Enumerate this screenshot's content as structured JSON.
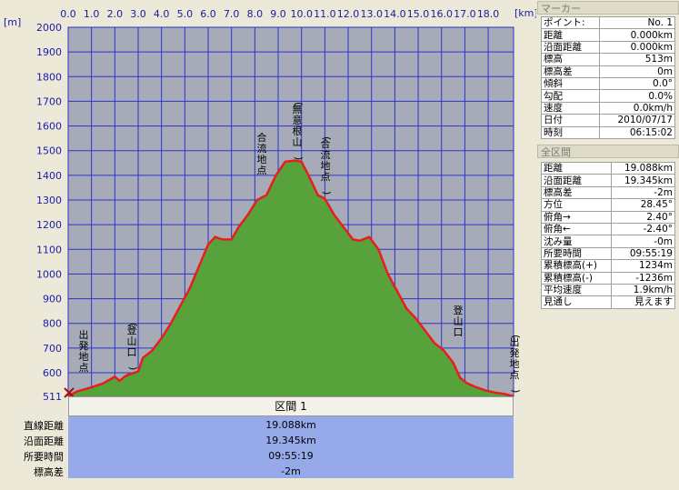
{
  "chart_data": {
    "type": "area",
    "xunit": "[km]",
    "yunit": "[m]",
    "xlim": [
      0,
      19.088
    ],
    "ylim": [
      511,
      2000
    ],
    "x_ticks": [
      "0.0",
      "1.0",
      "2.0",
      "3.0",
      "4.0",
      "5.0",
      "6.0",
      "7.0",
      "8.0",
      "9.0",
      "10.0",
      "11.0",
      "12.0",
      "13.0",
      "14.0",
      "15.0",
      "16.0",
      "17.0",
      "18.0"
    ],
    "y_ticks": [
      "2000",
      "1900",
      "1800",
      "1700",
      "1600",
      "1500",
      "1400",
      "1300",
      "1200",
      "1100",
      "1000",
      "900",
      "800",
      "700",
      "600",
      "511"
    ],
    "series": [
      {
        "x": [
          0,
          0.4,
          1.0,
          1.5,
          2.0,
          2.2,
          2.5,
          3.0,
          3.2,
          3.6,
          4.0,
          4.4,
          4.8,
          5.2,
          5.6,
          6.0,
          6.3,
          6.6,
          7.0,
          7.3,
          7.7,
          8.1,
          8.5,
          8.9,
          9.3,
          9.7,
          10.0,
          10.3,
          10.7,
          11.0,
          11.4,
          11.8,
          12.2,
          12.5,
          12.9,
          13.3,
          13.7,
          14.1,
          14.5,
          14.9,
          15.3,
          15.7,
          16.1,
          16.5,
          16.8,
          17.1,
          17.5,
          17.9,
          18.3,
          18.7,
          19.088
        ],
        "y": [
          513,
          530,
          545,
          560,
          585,
          570,
          590,
          605,
          660,
          690,
          740,
          800,
          870,
          940,
          1030,
          1120,
          1150,
          1140,
          1140,
          1190,
          1240,
          1300,
          1320,
          1400,
          1455,
          1460,
          1455,
          1400,
          1320,
          1305,
          1240,
          1190,
          1140,
          1135,
          1150,
          1100,
          1000,
          930,
          860,
          820,
          770,
          720,
          690,
          640,
          580,
          560,
          545,
          533,
          525,
          520,
          511
        ]
      }
    ],
    "annotations": [
      "出発地点",
      "(登山口)",
      "合流地点",
      "(無意根山)",
      "(合流地点)",
      "登山口",
      "(出発地点)"
    ],
    "fill": "#57a23a",
    "line": "#e81e1e",
    "grid": true
  },
  "section": {
    "header": "区間 1",
    "rows": [
      {
        "label": "直線距離",
        "value": "19.088km"
      },
      {
        "label": "沿面距離",
        "value": "19.345km"
      },
      {
        "label": "所要時間",
        "value": "09:55:19"
      },
      {
        "label": "標高差",
        "value": "-2m"
      }
    ]
  },
  "marker_panel": {
    "title": "マーカー",
    "rows": [
      {
        "label": "ポイント:",
        "value": "No. 1"
      },
      {
        "label": "距離",
        "value": "0.000km"
      },
      {
        "label": "沿面距離",
        "value": "0.000km"
      },
      {
        "label": "標高",
        "value": "513m"
      },
      {
        "label": "標高差",
        "value": "0m"
      },
      {
        "label": "傾斜",
        "value": "0.0°"
      },
      {
        "label": "勾配",
        "value": "0.0%"
      },
      {
        "label": "速度",
        "value": "0.0km/h"
      },
      {
        "label": "日付",
        "value": "2010/07/17"
      },
      {
        "label": "時刻",
        "value": "06:15:02"
      }
    ]
  },
  "all_panel": {
    "title": "全区間",
    "rows": [
      {
        "label": "距離",
        "value": "19.088km"
      },
      {
        "label": "沿面距離",
        "value": "19.345km"
      },
      {
        "label": "標高差",
        "value": "-2m"
      },
      {
        "label": "方位",
        "value": "28.45°"
      },
      {
        "label": "俯角→",
        "value": "2.40°"
      },
      {
        "label": "俯角←",
        "value": "-2.40°"
      },
      {
        "label": "沈み量",
        "value": "-0m"
      },
      {
        "label": "所要時間",
        "value": "09:55:19"
      },
      {
        "label": "累積標高(+)",
        "value": "1234m"
      },
      {
        "label": "累積標高(-)",
        "value": "-1236m"
      },
      {
        "label": "平均速度",
        "value": "1.9km/h"
      },
      {
        "label": "見通し",
        "value": "見えます"
      }
    ]
  }
}
